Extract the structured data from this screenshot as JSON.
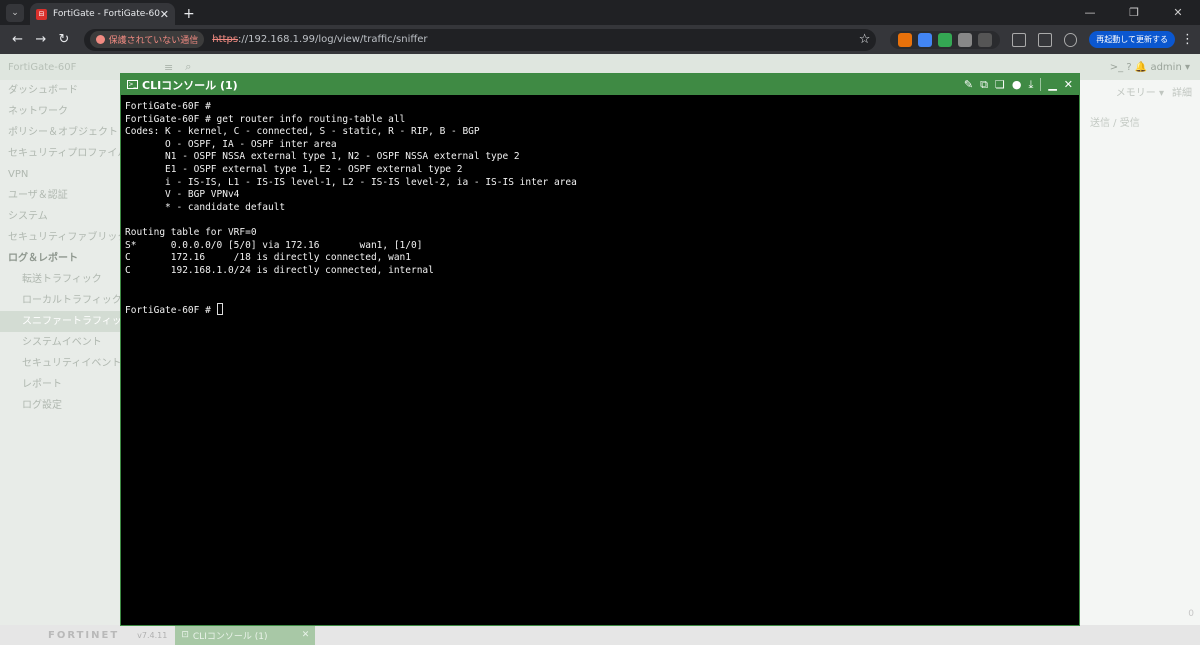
{
  "browser": {
    "tab_title": "FortiGate - FortiGate-60F",
    "security_chip": "保護されていない通信",
    "url_scheme": "https",
    "url_rest": "://192.168.1.99/log/view/traffic/sniffer",
    "restart_button": "再起動して更新する"
  },
  "app": {
    "brand": "FortiGate-60F",
    "header_right": ">_   ?   🔔   admin ▾",
    "main_tools": [
      "メモリー ▾",
      "詳細"
    ],
    "column_header": "送信 / 受信",
    "sidebar": [
      {
        "label": "ダッシュボード",
        "type": "section"
      },
      {
        "label": "ネットワーク",
        "type": "section"
      },
      {
        "label": "ポリシー＆オブジェクト",
        "type": "section"
      },
      {
        "label": "セキュリティプロファイル",
        "type": "section"
      },
      {
        "label": "VPN",
        "type": "section"
      },
      {
        "label": "ユーザ＆認証",
        "type": "section"
      },
      {
        "label": "システム",
        "type": "section"
      },
      {
        "label": "セキュリティファブリック",
        "type": "section"
      },
      {
        "label": "ログ＆レポート",
        "type": "section"
      },
      {
        "label": "転送トラフィック",
        "type": "sub"
      },
      {
        "label": "ローカルトラフィック",
        "type": "sub"
      },
      {
        "label": "スニファートラフィック",
        "type": "sub"
      },
      {
        "label": "システムイベント",
        "type": "sub"
      },
      {
        "label": "セキュリティイベント",
        "type": "sub"
      },
      {
        "label": "レポート",
        "type": "sub"
      },
      {
        "label": "ログ設定",
        "type": "sub"
      }
    ],
    "footer_logo": "FORTINET",
    "version": "v7.4.11",
    "bottom_tab": "CLIコンソール (1)",
    "counter": "0"
  },
  "cli": {
    "title": "CLIコンソール (1)",
    "output": "FortiGate-60F #\nFortiGate-60F # get router info routing-table all\nCodes: K - kernel, C - connected, S - static, R - RIP, B - BGP\n       O - OSPF, IA - OSPF inter area\n       N1 - OSPF NSSA external type 1, N2 - OSPF NSSA external type 2\n       E1 - OSPF external type 1, E2 - OSPF external type 2\n       i - IS-IS, L1 - IS-IS level-1, L2 - IS-IS level-2, ia - IS-IS inter area\n       V - BGP VPNv4\n       * - candidate default\n\nRouting table for VRF=0\nS*      0.0.0.0/0 [5/0] via 172.16       wan1, [1/0]\nC       172.16     /18 is directly connected, wan1\nC       192.168.1.0/24 is directly connected, internal\n\n\nFortiGate-60F # "
  }
}
